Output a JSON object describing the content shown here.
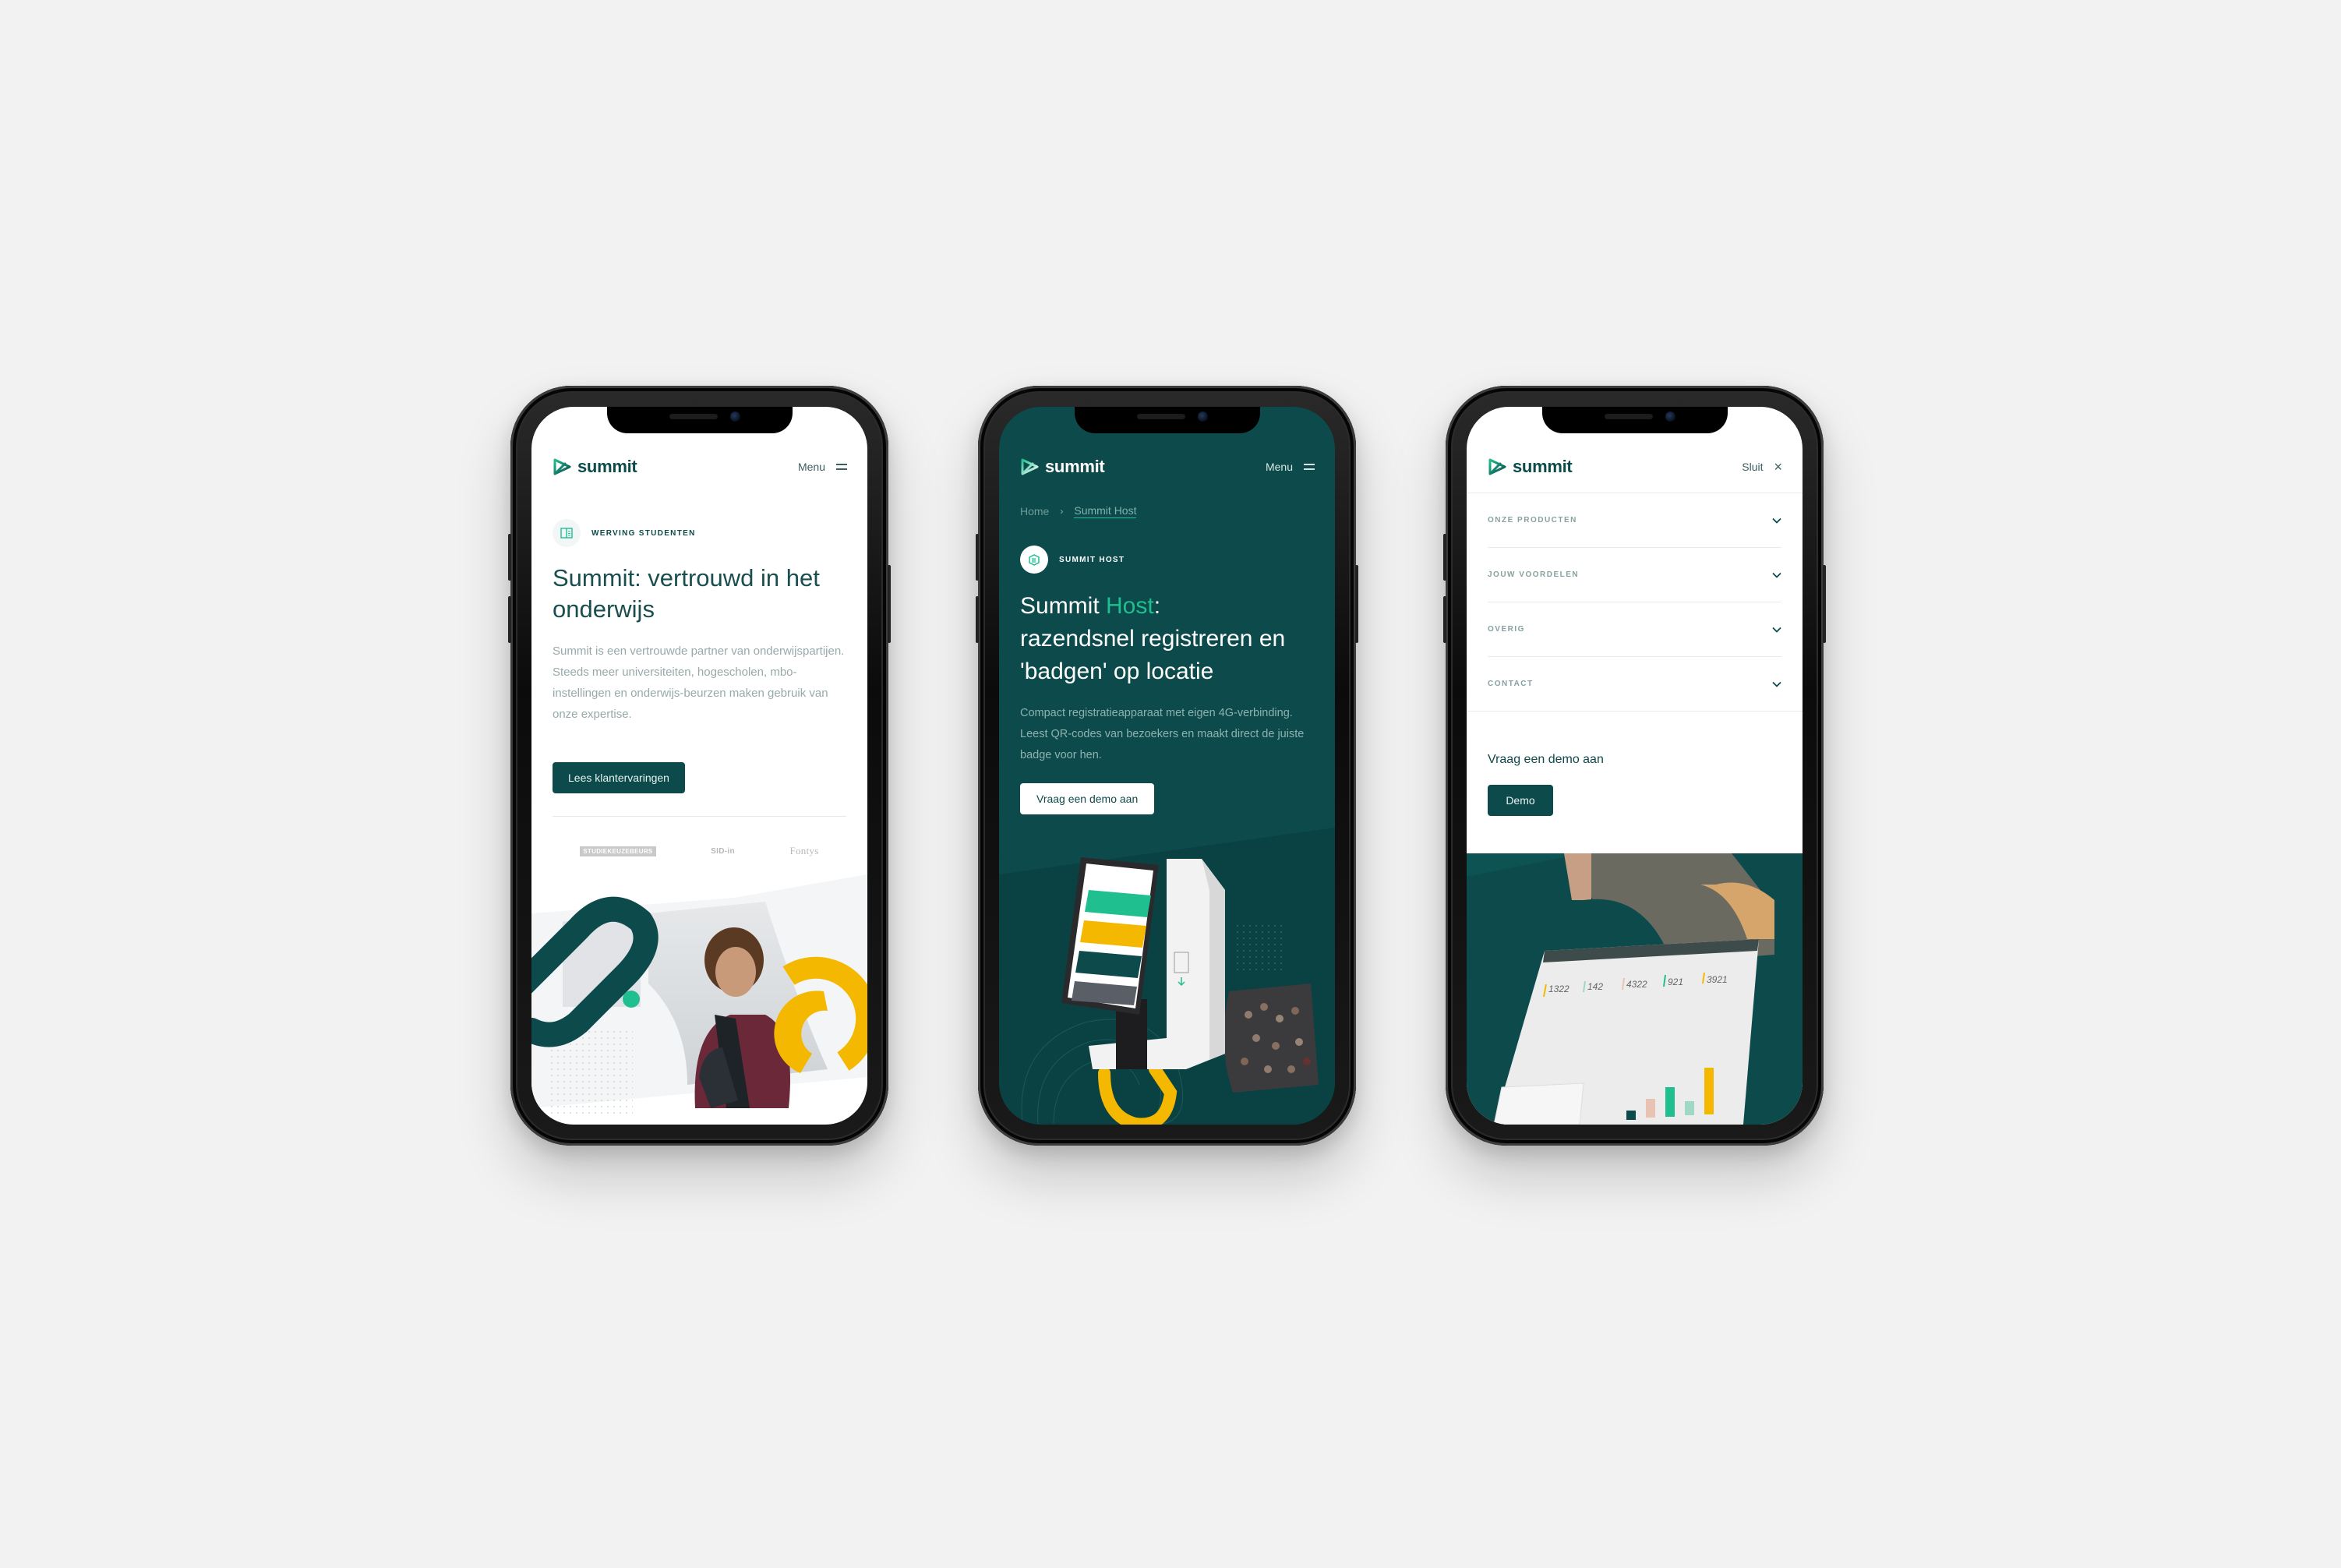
{
  "colors": {
    "background": "#f2f2f2",
    "brand_dark_teal": "#0d4a4b",
    "brand_green": "#1fbf8f",
    "accent_yellow": "#f5b800",
    "text_muted": "#97a9a9"
  },
  "phones": [
    {
      "theme": "light",
      "header": {
        "brand": "summit",
        "menu_label": "Menu",
        "menu_icon": "hamburger-icon"
      },
      "tag": {
        "icon": "book-icon",
        "label": "WERVING STUDENTEN"
      },
      "title": "Summit: vertrouwd in het onderwijs",
      "title_lines": [
        "Summit: vertrouwd in het",
        "onderwijs"
      ],
      "lead": "Summit is een vertrouwde partner van onderwijspartijen. Steeds meer universiteiten, hogescholen, mbo-instellingen en onderwijs-beurzen maken gebruik van onze expertise.",
      "cta_label": "Lees klantervaringen",
      "client_logos": [
        "STUDIEKEUZEBEURS",
        "SID-in",
        "Fontys"
      ]
    },
    {
      "theme": "dark",
      "header": {
        "brand": "summit",
        "menu_label": "Menu",
        "menu_icon": "hamburger-icon"
      },
      "breadcrumb": [
        {
          "label": "Home"
        },
        {
          "label": "Summit Host",
          "current": true
        }
      ],
      "breadcrumb_separator": "›",
      "tag": {
        "icon": "kiosk-icon",
        "label": "SUMMIT HOST"
      },
      "title_prefix": "Summit ",
      "title_accent": "Host",
      "title_suffix": ":",
      "title_line2": "razendsnel registreren en",
      "title_line3": "'badgen' op locatie",
      "lead": "Compact registratieapparaat met eigen 4G-verbinding. Leest QR-codes van bezoekers en maakt direct de juiste badge voor hen.",
      "cta_label": "Vraag een demo aan"
    },
    {
      "theme": "light-menu-open",
      "header": {
        "brand": "summit",
        "close_label": "Sluit",
        "close_icon": "close-icon"
      },
      "nav_items": [
        {
          "label": "ONZE PRODUCTEN"
        },
        {
          "label": "JOUW VOORDELEN"
        },
        {
          "label": "OVERIG"
        },
        {
          "label": "CONTACT"
        }
      ],
      "demo_title": "Vraag een demo aan",
      "demo_button": "Demo",
      "dashboard_stats": [
        "1322",
        "142",
        "4322",
        "921",
        "3921"
      ]
    }
  ]
}
